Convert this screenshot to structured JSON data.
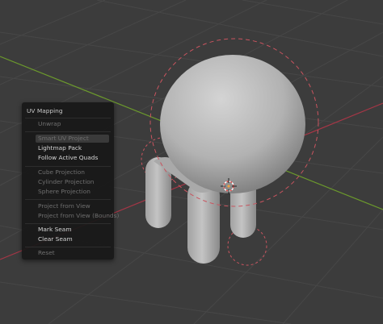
{
  "colors": {
    "viewport_bg": "#3c3c3c",
    "grid_line": "#464646",
    "x_axis": "#a53646",
    "y_axis": "#6c9a2c",
    "mesh_body": "#b8b8b8",
    "proportional_circle": "#c9545f"
  },
  "viewport": {
    "icons": [
      "3d-cursor-icon",
      "origin-point-icon"
    ]
  },
  "uv_menu": {
    "title": "UV Mapping",
    "items": [
      {
        "label": "Unwrap",
        "enabled": false
      },
      {
        "label": "Smart UV Project",
        "enabled": false,
        "highlighted": true
      },
      {
        "label": "Lightmap Pack",
        "enabled": true
      },
      {
        "label": "Follow Active Quads",
        "enabled": true
      },
      {
        "label": "Cube Projection",
        "enabled": false
      },
      {
        "label": "Cylinder Projection",
        "enabled": false
      },
      {
        "label": "Sphere Projection",
        "enabled": false
      },
      {
        "label": "Project from View",
        "enabled": false
      },
      {
        "label": "Project from View (Bounds)",
        "enabled": false
      },
      {
        "label": "Mark Seam",
        "enabled": true
      },
      {
        "label": "Clear Seam",
        "enabled": true
      },
      {
        "label": "Reset",
        "enabled": false
      }
    ]
  }
}
